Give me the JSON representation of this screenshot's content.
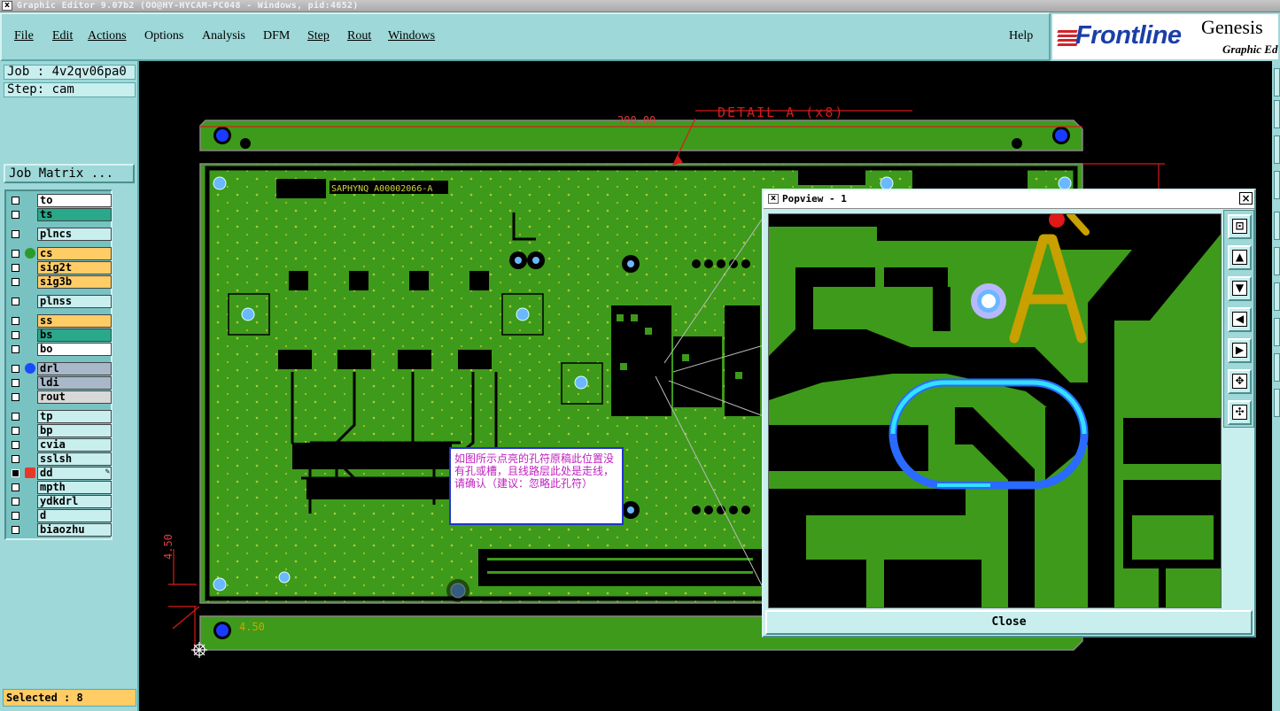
{
  "window": {
    "title": "Graphic Editor 9.07b2 (OO@HY-HYCAM-PC048 - Windows, pid:4652)",
    "icon": "x-window-icon"
  },
  "menu": {
    "file": "File",
    "edit": "Edit",
    "actions": "Actions",
    "options": "Options",
    "analysis": "Analysis",
    "dfm": "DFM",
    "step": "Step",
    "rout": "Rout",
    "windows": "Windows",
    "help": "Help"
  },
  "brand": {
    "logo": "Frontline",
    "product": "Genesis",
    "subtitle": "Graphic Ed"
  },
  "job": {
    "name": "Job : 4v2qv06pa0",
    "step": "Step: cam",
    "matrix_button": "Job Matrix ..."
  },
  "layers": [
    {
      "name": "to",
      "color": "#ffffff",
      "checked": false
    },
    {
      "name": "ts",
      "color": "#2aa88a",
      "checked": false
    },
    {
      "name": "plncs",
      "color": "#c8eeee",
      "checked": false
    },
    {
      "name": "cs",
      "color": "#ffcc66",
      "checked": false,
      "active_dot": "#2a9a2a"
    },
    {
      "name": "sig2t",
      "color": "#ffcc66",
      "checked": false
    },
    {
      "name": "sig3b",
      "color": "#ffcc66",
      "checked": false
    },
    {
      "name": "plnss",
      "color": "#c8eeee",
      "checked": false
    },
    {
      "name": "ss",
      "color": "#ffcc66",
      "checked": false
    },
    {
      "name": "bs",
      "color": "#2aa88a",
      "checked": false
    },
    {
      "name": "bo",
      "color": "#ffffff",
      "checked": false
    },
    {
      "name": "drl",
      "color": "#a8b8c8",
      "checked": false,
      "active_dot": "#1a4aff"
    },
    {
      "name": "ldi",
      "color": "#a8b8c8",
      "checked": false
    },
    {
      "name": "rout",
      "color": "#d8d8d8",
      "checked": false
    },
    {
      "name": "tp",
      "color": "#c8eeee",
      "checked": false
    },
    {
      "name": "bp",
      "color": "#c8eeee",
      "checked": false
    },
    {
      "name": "cvia",
      "color": "#c8eeee",
      "checked": false
    },
    {
      "name": "sslsh",
      "color": "#c8eeee",
      "checked": false
    },
    {
      "name": "dd",
      "color": "#c8eeee",
      "checked": true,
      "work": true
    },
    {
      "name": "mpth",
      "color": "#c8eeee",
      "checked": false
    },
    {
      "name": "ydkdrl",
      "color": "#c8eeee",
      "checked": false
    },
    {
      "name": "d",
      "color": "#c8eeee",
      "checked": false
    },
    {
      "name": "biaozhu",
      "color": "#c8eeee",
      "checked": false
    }
  ],
  "status": {
    "selected": "Selected : 8"
  },
  "board": {
    "detail_label": "DETAIL A (x8)",
    "dimension_top": "200.00",
    "dimension_left": "4.50",
    "dimension_bottom": "4.50",
    "part_label": "SAPHYNQ A00002066-A"
  },
  "note": {
    "text": "如图所示点亮的孔符原稿此位置没有孔或槽，且线路层此处是走线，请确认（建议：忽略此孔符）"
  },
  "popview": {
    "title": "Popview - 1",
    "close_button": "Close",
    "marker_letter": "A",
    "tools": [
      "zoom-home-icon",
      "zoom-in-icon",
      "zoom-out-icon",
      "pan-left-icon",
      "pan-right-icon",
      "fit-icon",
      "center-icon"
    ]
  }
}
